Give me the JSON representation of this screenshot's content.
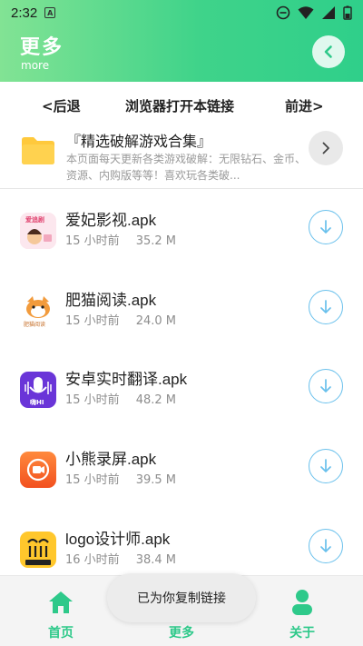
{
  "status_bar": {
    "time": "2:32",
    "notification_icon": "A"
  },
  "header": {
    "title": "更多",
    "subtitle": "more"
  },
  "nav": {
    "back_label": "<后退",
    "open_browser_label": "浏览器打开本链接",
    "forward_label": "前进>"
  },
  "collection": {
    "title": "『精选破解游戏合集』",
    "description": "本页面每天更新各类游戏破解：无限钻石、金币、资源、内购版等等！喜欢玩各类破..."
  },
  "files": [
    {
      "name": "爱妃影视.apk",
      "time": "15 小时前",
      "size": "35.2 M",
      "icon_label": "爱追剧"
    },
    {
      "name": "肥猫阅读.apk",
      "time": "15 小时前",
      "size": "24.0 M",
      "icon_label": "肥猫阅读"
    },
    {
      "name": "安卓实时翻译.apk",
      "time": "15 小时前",
      "size": "48.2 M",
      "icon_label": "嗨HI"
    },
    {
      "name": "小熊录屏.apk",
      "time": "15 小时前",
      "size": "39.5 M",
      "icon_label": ""
    },
    {
      "name": "logo设计师.apk",
      "time": "16 小时前",
      "size": "38.4 M",
      "icon_label": ""
    }
  ],
  "bottom_nav": {
    "home_label": "首页",
    "more_label": "更多",
    "about_label": "关于"
  },
  "toast": {
    "message": "已为你复制链接"
  },
  "colors": {
    "accent": "#2ec98a",
    "download_ring": "#69c0ec",
    "folder": "#ffc93c"
  }
}
